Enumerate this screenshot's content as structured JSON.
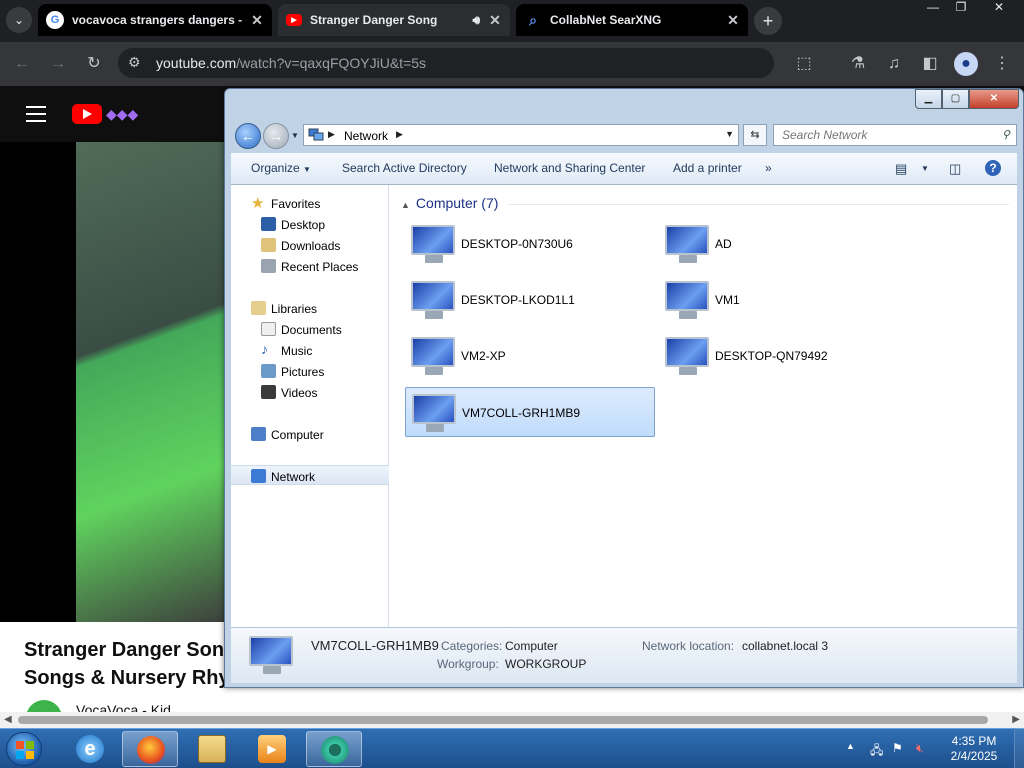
{
  "browser": {
    "tabs": [
      {
        "title": "vocavoca strangers dangers - G",
        "favicon": "google-g-icon"
      },
      {
        "title": "Stranger Danger Song",
        "favicon": "youtube-icon",
        "audio": true
      },
      {
        "title": "CollabNet SearXNG",
        "favicon": "search-icon"
      }
    ],
    "url_domain": "youtube.com",
    "url_path": "/watch?v=qaxqFQOYJiU&t=5s"
  },
  "youtube": {
    "video_title_line1": "Stranger Danger Song",
    "video_title_line2": "Songs & Nursery Rhym",
    "channel": "VocaVoca - Kid"
  },
  "explorer": {
    "location": "Network",
    "search_placeholder": "Search Network",
    "commands": [
      "Organize",
      "Search Active Directory",
      "Network and Sharing Center",
      "Add a printer",
      "»"
    ],
    "nav": {
      "favorites": "Favorites",
      "desktop": "Desktop",
      "downloads": "Downloads",
      "recent": "Recent Places",
      "libraries": "Libraries",
      "documents": "Documents",
      "music": "Music",
      "pictures": "Pictures",
      "videos": "Videos",
      "computer": "Computer",
      "network": "Network"
    },
    "group_header": "Computer (7)",
    "computers": [
      "DESKTOP-0N730U6",
      "AD",
      "DESKTOP-LKOD1L1",
      "VM1",
      "VM2-XP",
      "DESKTOP-QN79492",
      "VM7COLL-GRH1MB9"
    ],
    "selected": "VM7COLL-GRH1MB9",
    "details": {
      "name": "VM7COLL-GRH1MB9",
      "categories_label": "Categories:",
      "categories_value": "Computer",
      "workgroup_label": "Workgroup:",
      "workgroup_value": "WORKGROUP",
      "netloc_label": "Network location:",
      "netloc_value": "collabnet.local 3"
    }
  },
  "taskbar": {
    "time": "4:35 PM",
    "date": "2/4/2025"
  }
}
